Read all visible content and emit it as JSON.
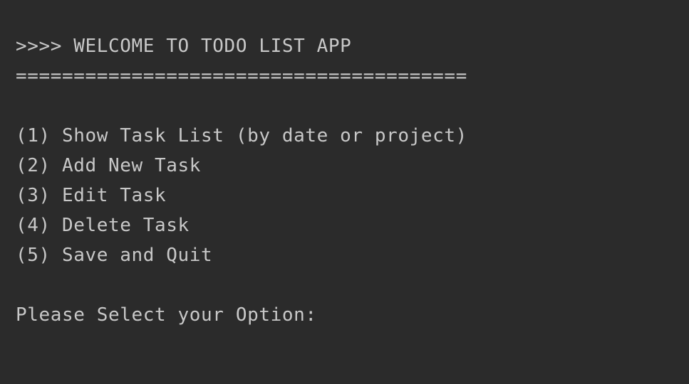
{
  "console": {
    "header": {
      "welcome": ">>>> WELCOME TO TODO LIST APP",
      "separator": "======================================="
    },
    "menu": {
      "items": [
        {
          "label": "(1) Show Task List (by date or project)"
        },
        {
          "label": "(2) Add New Task"
        },
        {
          "label": "(3) Edit Task"
        },
        {
          "label": "(4) Delete Task"
        },
        {
          "label": "(5) Save and Quit"
        }
      ]
    },
    "prompt": {
      "text": "Please Select your Option:"
    }
  },
  "colors": {
    "background": "#2b2b2b",
    "text": "#c8c8c8"
  }
}
